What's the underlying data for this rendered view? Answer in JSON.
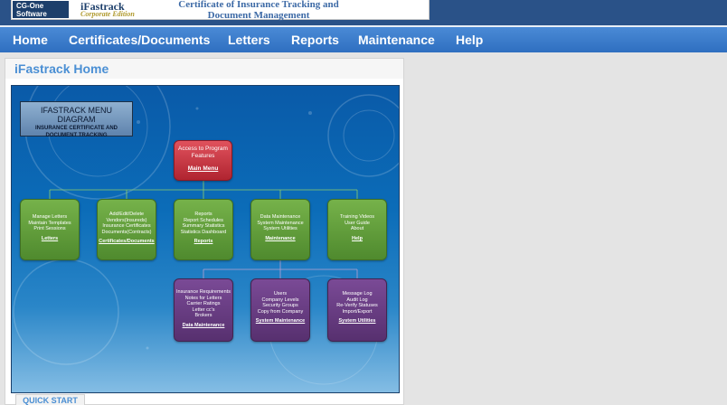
{
  "header": {
    "logo_badge": "CG-One Software",
    "product_name": "iFastrack",
    "product_edition": "Corporate Edition",
    "tagline": "Certificate of Insurance Tracking and Document Management"
  },
  "nav": {
    "items": [
      "Home",
      "Certificates/Documents",
      "Letters",
      "Reports",
      "Maintenance",
      "Help"
    ]
  },
  "panel": {
    "title": "iFastrack Home",
    "tab_label": "QUICK START"
  },
  "diagram": {
    "title": "IFASTRACK MENU DIAGRAM",
    "subtitle": "INSURANCE CERTIFICATE AND DOCUMENT TRACKING",
    "main": {
      "text": "Access to Program\nFeatures",
      "link": "Main Menu"
    },
    "level1": [
      {
        "text": "Manage Letters\nMaintain Templates\nPrint Sessions",
        "link": "Letters"
      },
      {
        "text": "Add/Edit/Delete\nVendors(Insureds)\nInsurance Certificates\nDocuments(Contracts)",
        "link": "Certificates/Documents"
      },
      {
        "text": "Reports\nReport Schedules\nSummary Statistics\nStatistics Dashboard",
        "link": "Reports"
      },
      {
        "text": "Data Maintenance\nSystem Maintenance\nSystem Utilities",
        "link": "Maintenance"
      },
      {
        "text": "Training Videos\nUser Guide\nAbout",
        "link": "Help"
      }
    ],
    "level2": [
      {
        "text": "Insurance Requirements\nNotes for Letters\nCarrier Ratings\nLetter cc's\nBrokers",
        "link": "Data Maintenance"
      },
      {
        "text": "Users\nCompany Levels\nSecurity Groups\nCopy from Company",
        "link": "System Maintenance"
      },
      {
        "text": "Message Log\nAudit Log\nRe-Verify Statuses\nImport/Export",
        "link": "System Utilities"
      }
    ]
  },
  "colors": {
    "nav_blue": "#3a7bcb",
    "header_blue": "#2a5288",
    "main_menu_red": "#c8333f",
    "level1_green": "#5f9a3a",
    "level2_purple": "#64397e"
  }
}
